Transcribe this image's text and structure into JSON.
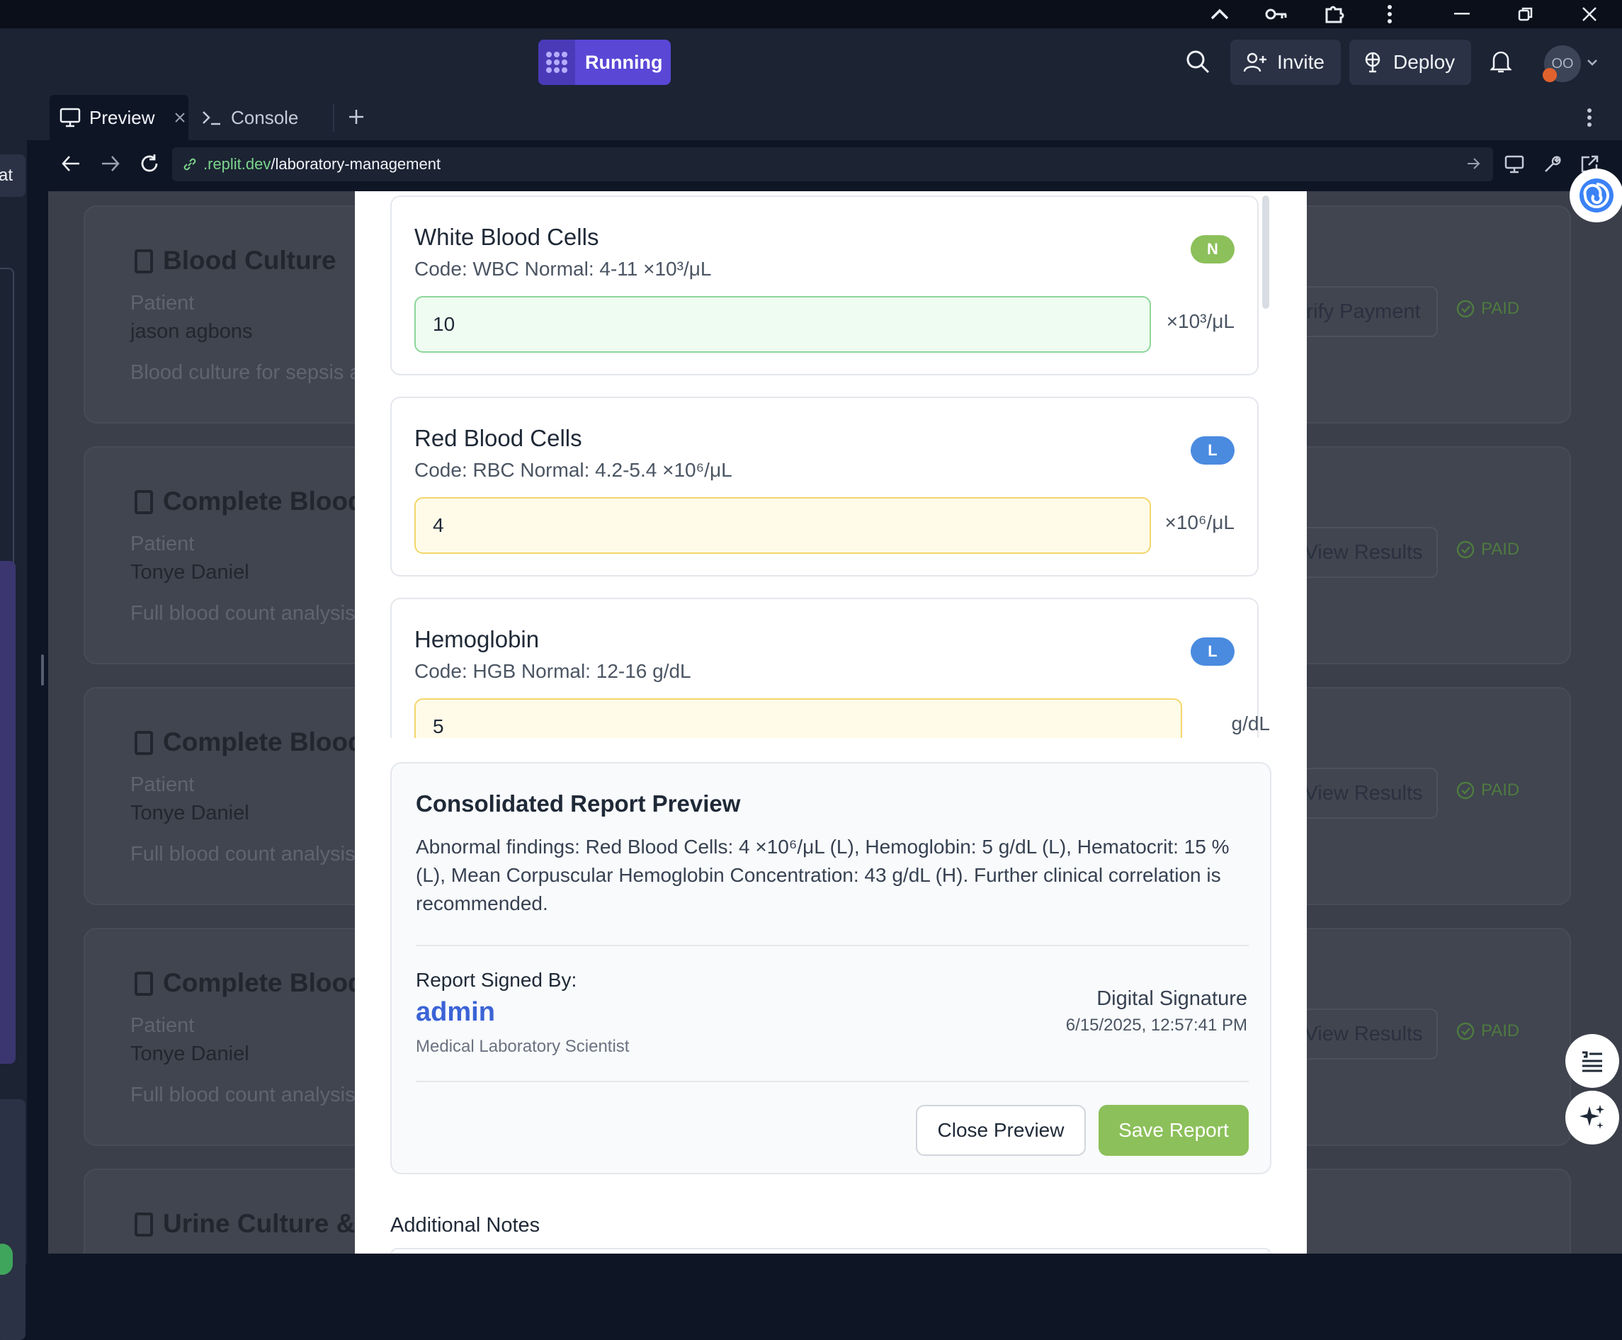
{
  "workspace": {
    "run_label": "Running",
    "invite_label": "Invite",
    "deploy_label": "Deploy",
    "avatar_initials": "OO"
  },
  "tabs": [
    {
      "label": "Preview"
    },
    {
      "label": "Console"
    }
  ],
  "url": {
    "host": ".replit.dev",
    "path": "/laboratory-management"
  },
  "left_panel": {
    "chat_label": "at"
  },
  "background_tests": [
    {
      "title": "Blood Culture",
      "patient_label": "Patient",
      "patient": "jason agbons",
      "description": "Blood culture for sepsis a",
      "action": "rify Payment",
      "status": "PAID"
    },
    {
      "title": "Complete Blood",
      "patient_label": "Patient",
      "patient": "Tonye Daniel",
      "description": "Full blood count analysis",
      "action": "View Results",
      "status": "PAID"
    },
    {
      "title": "Complete Blood",
      "patient_label": "Patient",
      "patient": "Tonye Daniel",
      "description": "Full blood count analysis",
      "action": "View Results",
      "status": "PAID"
    },
    {
      "title": "Complete Blood",
      "patient_label": "Patient",
      "patient": "Tonye Daniel",
      "description": "Full blood count analysis",
      "action": "View Results",
      "status": "PAID"
    },
    {
      "title": "Urine Culture &",
      "patient_label": "",
      "patient": "",
      "description": "",
      "action": "",
      "status": ""
    }
  ],
  "parameters": [
    {
      "name": "White Blood Cells",
      "meta": "Code: WBC  Normal: 4-11 ×10³/μL",
      "flag": "N",
      "value": "10",
      "unit": "×10³/μL"
    },
    {
      "name": "Red Blood Cells",
      "meta": "Code: RBC  Normal: 4.2-5.4 ×10⁶/μL",
      "flag": "L",
      "value": "4",
      "unit": "×10⁶/μL"
    },
    {
      "name": "Hemoglobin",
      "meta": "Code: HGB  Normal: 12-16 g/dL",
      "flag": "L",
      "value": "5",
      "unit": "g/dL"
    }
  ],
  "report": {
    "title": "Consolidated Report Preview",
    "text": "Abnormal findings: Red Blood Cells: 4 ×10⁶/μL (L), Hemoglobin: 5 g/dL (L), Hematocrit: 15 % (L), Mean Corpuscular Hemoglobin Concentration: 43 g/dL (H). Further clinical correlation is recommended.",
    "signed_by_label": "Report Signed By:",
    "signer": "admin",
    "role": "Medical Laboratory Scientist",
    "signature_type": "Digital Signature",
    "signature_date": "6/15/2025, 12:57:41 PM",
    "close_label": "Close Preview",
    "save_label": "Save Report"
  },
  "notes_label": "Additional Notes",
  "colors": {
    "normal": "#8cc05a",
    "low": "#4a8be0",
    "normal_bg": "#effcf1",
    "low_bg": "#fffbe8"
  }
}
